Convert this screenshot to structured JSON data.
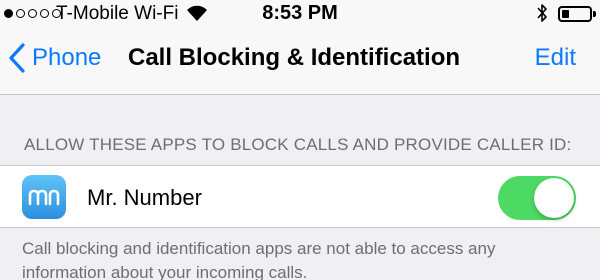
{
  "status_bar": {
    "signal_bars_filled": 1,
    "signal_bars_total": 5,
    "carrier": "T-Mobile Wi-Fi",
    "wifi_icon": "wifi-icon",
    "time": "8:53 PM",
    "bluetooth_icon": "bluetooth-icon",
    "battery_level_fraction": 0.25
  },
  "nav": {
    "back_label": "Phone",
    "title": "Call Blocking & Identification",
    "edit_label": "Edit"
  },
  "section": {
    "header": "ALLOW THESE APPS TO BLOCK CALLS AND PROVIDE CALLER ID:",
    "apps": [
      {
        "name": "Mr. Number",
        "icon": "mr-number-app-icon",
        "enabled": true
      }
    ],
    "footer": "Call blocking and identification apps are not able to access any information about your incoming calls."
  },
  "colors": {
    "accent": "#0a7aff",
    "toggle_on": "#4cd964",
    "group_background": "#efeff4",
    "secondary_text": "#6d6d72"
  }
}
